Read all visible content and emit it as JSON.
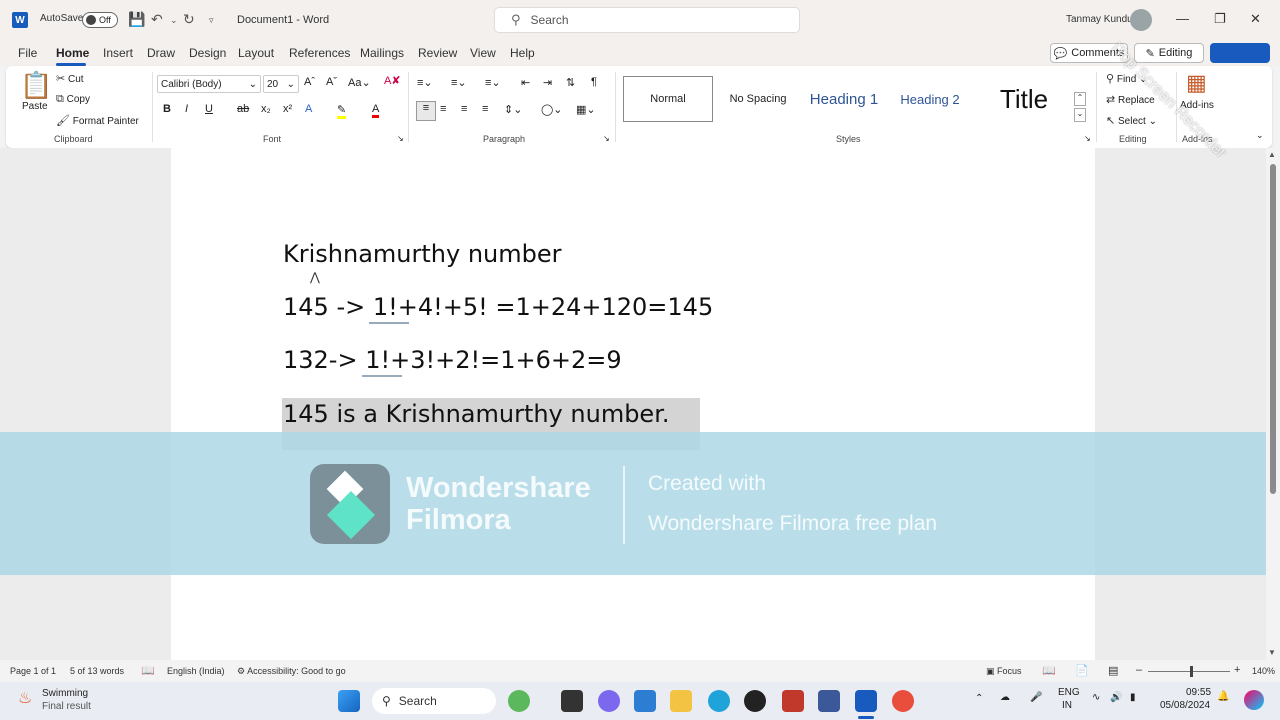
{
  "titlebar": {
    "autosave_label": "AutoSave",
    "autosave_state": "Off",
    "doc_title": "Document1 - Word",
    "search_placeholder": "Search",
    "user_name": "Tanmay Kundu"
  },
  "menu": {
    "items": [
      "File",
      "Home",
      "Insert",
      "Draw",
      "Design",
      "Layout",
      "References",
      "Mailings",
      "Review",
      "View",
      "Help"
    ],
    "active": "Home",
    "comments_label": "Comments",
    "editing_label": "Editing"
  },
  "ribbon": {
    "clipboard": {
      "paste": "Paste",
      "cut": "Cut",
      "copy": "Copy",
      "format_painter": "Format Painter",
      "label": "Clipboard"
    },
    "font": {
      "font_name": "Calibri (Body)",
      "font_size": "20",
      "label": "Font"
    },
    "paragraph": {
      "label": "Paragraph"
    },
    "styles": {
      "normal": "Normal",
      "no_spacing": "No Spacing",
      "heading1": "Heading 1",
      "heading2": "Heading 2",
      "title": "Title",
      "label": "Styles"
    },
    "editing": {
      "find": "Find",
      "replace": "Replace",
      "select": "Select",
      "label": "Editing"
    },
    "addins": {
      "button": "Add-ins",
      "label": "Add-ins"
    }
  },
  "document": {
    "lines": [
      "Krishnamurthy number",
      "145 -> 1!+4!+5! =1+24+120=145",
      "132-> 1!+3!+2!=1+6+2=9",
      "145 is a Krishnamurthy number."
    ]
  },
  "watermark": {
    "brand_line1": "Wondershare",
    "brand_line2": "Filmora",
    "created_with": "Created with",
    "plan": "Wondershare Filmora free plan",
    "recorder": "iTop Screen Recorder"
  },
  "statusbar": {
    "page": "Page 1 of 1",
    "words": "5 of 13 words",
    "language": "English (India)",
    "accessibility": "Accessibility: Good to go",
    "focus": "Focus",
    "zoom": "140%"
  },
  "taskbar": {
    "weather_title": "Swimming",
    "weather_sub": "Final result",
    "search": "Search",
    "lang_line1": "ENG",
    "lang_line2": "IN",
    "time": "09:55",
    "date": "05/08/2024"
  },
  "colors": {
    "word_blue": "#185abd",
    "watermark_bg": "#add8e6",
    "filmora_teal": "#5fe3c8"
  }
}
